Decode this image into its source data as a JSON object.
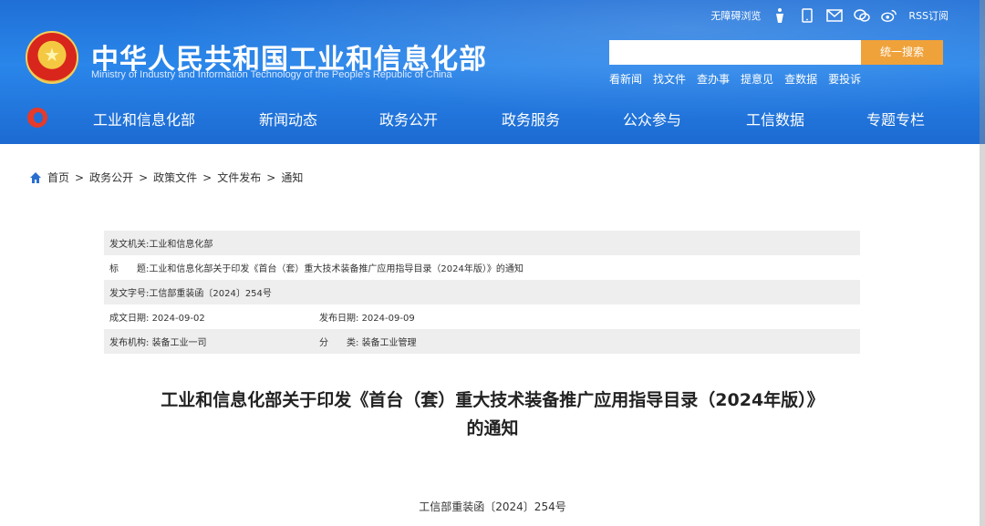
{
  "header": {
    "title": "中华人民共和国工业和信息化部",
    "subtitle": "Ministry of Industry and Information Technology of the People's Republic of China",
    "top_links": {
      "accessibility": "无障碍浏览",
      "rss": "RSS订阅"
    },
    "search": {
      "placeholder": "",
      "button": "统一搜索"
    },
    "quick_links": [
      "看新闻",
      "找文件",
      "查办事",
      "提意见",
      "查数据",
      "要投诉"
    ]
  },
  "nav": {
    "items": [
      "工业和信息化部",
      "新闻动态",
      "政务公开",
      "政务服务",
      "公众参与",
      "工信数据",
      "专题专栏"
    ]
  },
  "breadcrumb": [
    "首页",
    "政务公开",
    "政策文件",
    "文件发布",
    "通知"
  ],
  "breadcrumb_sep": ">",
  "meta": {
    "issuer_label": "发文机关:",
    "issuer": "工业和信息化部",
    "title_label": "标　　题:",
    "title": "工业和信息化部关于印发《首台（套）重大技术装备推广应用指导目录（2024年版）》的通知",
    "doc_no_label": "发文字号:",
    "doc_no": "工信部重装函〔2024〕254号",
    "created_label": "成文日期:",
    "created": "2024-09-02",
    "published_label": "发布日期:",
    "published": "2024-09-09",
    "org_label": "发布机构:",
    "org": "装备工业一司",
    "category_label": "分　　类:",
    "category": "装备工业管理"
  },
  "document": {
    "title_line1": "工业和信息化部关于印发《首台（套）重大技术装备推广应用指导目录（2024年版）》",
    "title_line2": "的通知",
    "number": "工信部重装函〔2024〕254号"
  },
  "colors": {
    "header_blue": "#1f6fd6",
    "search_orange": "#f0a23a",
    "meta_shade": "#eeeeee"
  }
}
